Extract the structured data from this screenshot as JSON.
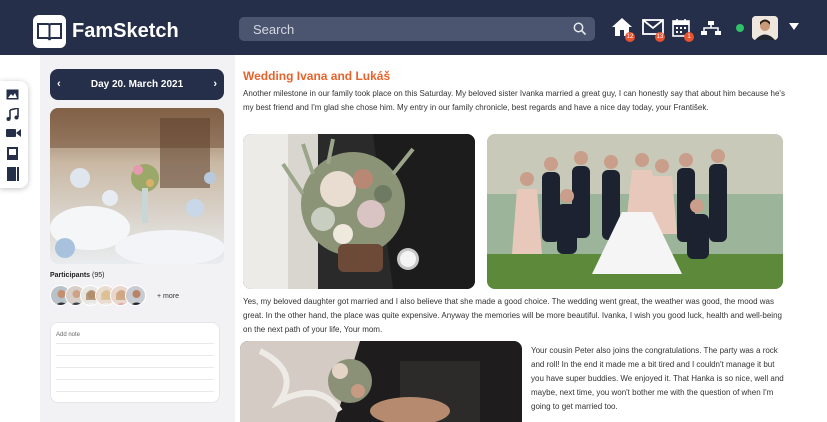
{
  "app": {
    "brand": "FamSketch"
  },
  "search": {
    "placeholder": "Search"
  },
  "nav": {
    "badges": {
      "home": "12",
      "messages": "13",
      "calendar": "1"
    },
    "accent_color": "#e8532f",
    "online_color": "#2fc26a"
  },
  "rail": {
    "icons": [
      "image-icon",
      "music-icon",
      "video-icon",
      "book-icon",
      "journal-icon"
    ]
  },
  "day": {
    "label": "Day 20. March 2021",
    "prev": "‹",
    "next": "›"
  },
  "participants": {
    "label": "Participants",
    "count": "(95)",
    "more": "+ more"
  },
  "note": {
    "placeholder": "Add note"
  },
  "post": {
    "title": "Wedding Ivana and Lukáš",
    "intro": "Another milestone in our family took place on this Saturday. My beloved sister Ivanka married a great guy, I can honestly say that about him because he's my best friend and I'm glad she chose him. My entry in our family chronicle, best regards and have a nice day today, your František.",
    "para2": "Yes, my beloved daughter got married and I also believe that she made a good choice. The wedding went great, the weather was good, the mood was great. In the other hand, the place was quite expensive. Anyway the memories will be more beautiful. Ivanka, I wish you good luck, health and well-being on the next path of your life, Your mom.",
    "para3": "Your cousin Peter also joins the congratulations. The party was a rock and roll! In the end it made me a bit tired and I couldn't manage it but you have super buddies. We enjoyed it. That Hanka is so nice, well and maybe, next time, you won't bother me with the question of when I'm going to get married too."
  },
  "colors": {
    "navbar": "#262f49",
    "title": "#e8632c"
  }
}
